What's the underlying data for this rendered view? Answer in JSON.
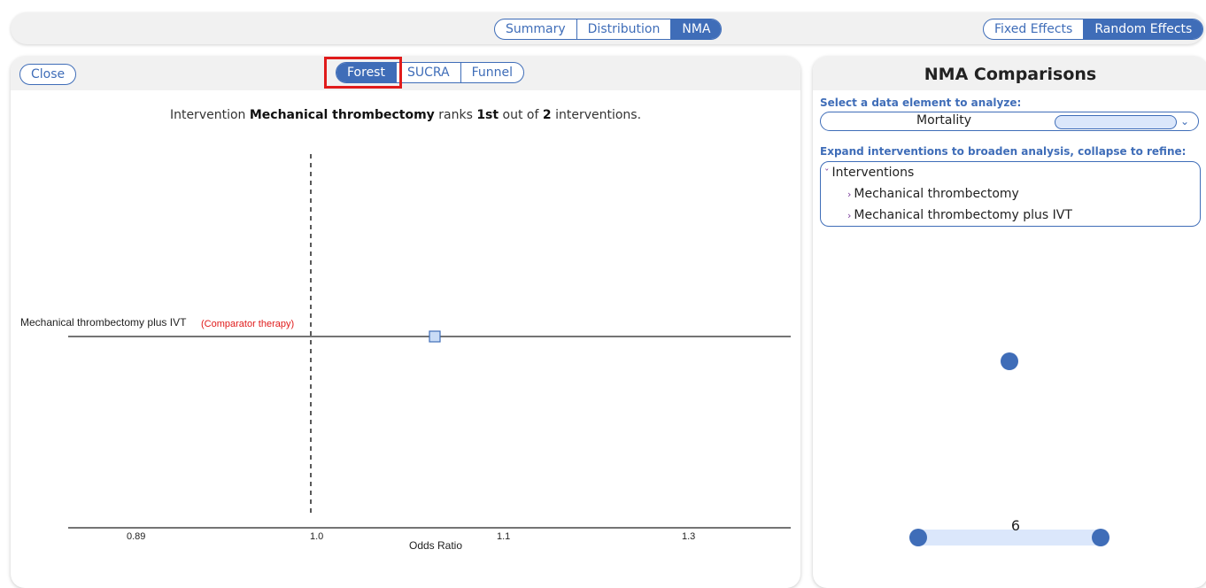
{
  "top_tabs": {
    "items": [
      "Summary",
      "Distribution",
      "NMA"
    ],
    "active": "NMA"
  },
  "effects_tabs": {
    "items": [
      "Fixed Effects",
      "Random Effects"
    ],
    "active": "Random Effects"
  },
  "left_panel": {
    "close_label": "Close",
    "view_tabs": {
      "items": [
        "Forest",
        "SUCRA",
        "Funnel"
      ],
      "active": "Forest"
    },
    "rank_sentence": {
      "prefix": "Intervention ",
      "intervention": "Mechanical thrombectomy",
      "middle": " ranks ",
      "rank": "1st",
      "out_of": " out of ",
      "total": "2",
      "suffix": " interventions."
    }
  },
  "chart_data": {
    "type": "forest",
    "xlabel": "Odds Ratio",
    "tick_labels": [
      "0.89",
      "1.0",
      "1.1",
      "1.3"
    ],
    "reference_line": 1.0,
    "rows": [
      {
        "label": "Mechanical thrombectomy plus IVT",
        "note": "(Comparator therapy)",
        "estimate": 1.1
      }
    ],
    "colors": {
      "marker_fill": "#c9dcf6",
      "marker_stroke": "#3f6db8",
      "note": "#e01b1b"
    }
  },
  "right_panel": {
    "title": "NMA Comparisons",
    "select_label": "Select a data element to analyze:",
    "select_value": "Mortality",
    "expand_label": "Expand interventions to broaden analysis, collapse to refine:",
    "tree": {
      "root": "Interventions",
      "children": [
        "Mechanical thrombectomy",
        "Mechanical thrombectomy plus IVT"
      ]
    },
    "network": {
      "edge_label": "6",
      "node_color": "#3f6db8",
      "edge_color": "#dbe7fb"
    }
  },
  "colors": {
    "accent": "#3f6db8",
    "highlight": "#e01b1b",
    "panel_header": "#f1f1f1"
  }
}
